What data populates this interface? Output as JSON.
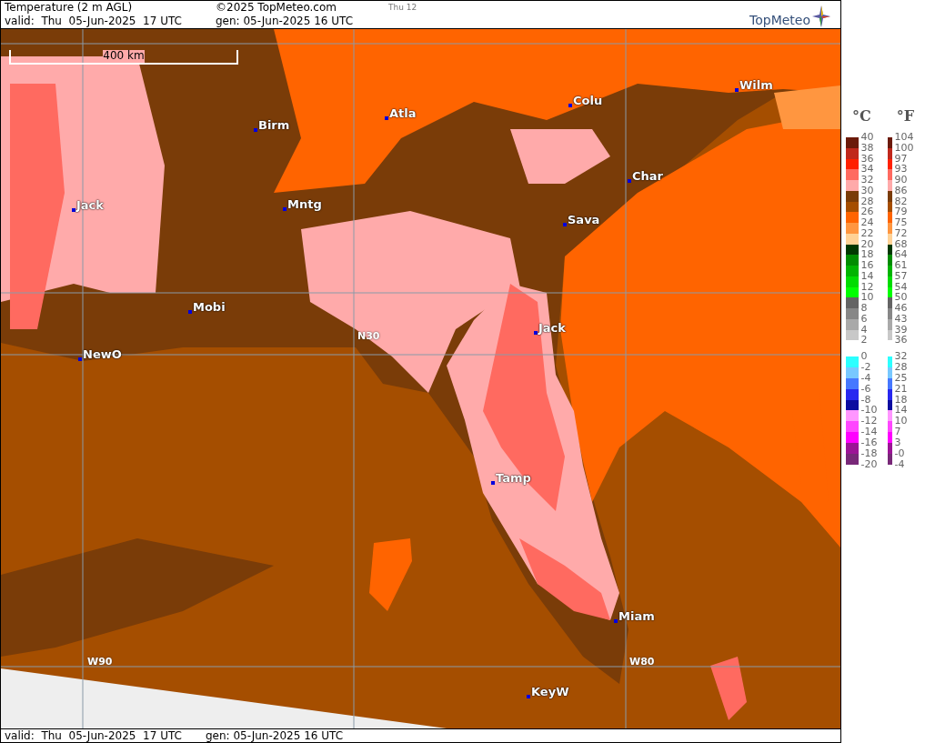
{
  "header": {
    "title": "Temperature (2 m AGL)",
    "copyright": "©2025 TopMeteo.com",
    "frame": "Thu 12",
    "valid": "valid:  Thu  05-Jun-2025  17 UTC",
    "generated": "gen: 05-Jun-2025 16 UTC",
    "logo": "TopMeteo"
  },
  "map": {
    "scale": "400 km",
    "cities": [
      "Birm",
      "Atla",
      "Colu",
      "Wilm",
      "Jack",
      "Mntg",
      "Char",
      "Sava",
      "Mobi",
      "Jack",
      "NewO",
      "Tamp",
      "Miam",
      "KeyW"
    ],
    "grid_labels": [
      "N30",
      "W90",
      "W80"
    ]
  },
  "legend": {
    "celsius_label": "°C",
    "fahrenheit_label": "°F",
    "groups": [
      {
        "ticks": [
          {
            "c": "40",
            "f": "104"
          },
          {
            "c": "38",
            "f": "100"
          },
          {
            "c": "36",
            "f": "97"
          },
          {
            "c": "34",
            "f": "93"
          },
          {
            "c": "32",
            "f": "90"
          },
          {
            "c": "30",
            "f": "86"
          },
          {
            "c": "28",
            "f": "82"
          },
          {
            "c": "26",
            "f": "79"
          },
          {
            "c": "24",
            "f": "75"
          },
          {
            "c": "22",
            "f": "72"
          },
          {
            "c": "20",
            "f": "68"
          },
          {
            "c": "18",
            "f": "64"
          },
          {
            "c": "16",
            "f": "61"
          },
          {
            "c": "14",
            "f": "57"
          },
          {
            "c": "12",
            "f": "54"
          },
          {
            "c": "10",
            "f": "50"
          },
          {
            "c": "8",
            "f": "46"
          },
          {
            "c": "6",
            "f": "43"
          },
          {
            "c": "4",
            "f": "39"
          },
          {
            "c": "2",
            "f": "36"
          }
        ],
        "bands": [
          {
            "color": "#6b1a0a"
          },
          {
            "color": "#c0281c"
          },
          {
            "color": "#ff2000"
          },
          {
            "color": "#ff6a60"
          },
          {
            "color": "#ffaaaa"
          },
          {
            "color": "#7a3c08"
          },
          {
            "color": "#a54e00"
          },
          {
            "color": "#ff6400"
          },
          {
            "color": "#ff9640"
          },
          {
            "color": "#ffd296"
          },
          {
            "color": "#003800"
          },
          {
            "color": "#008c00"
          },
          {
            "color": "#00b400"
          },
          {
            "color": "#00dc00"
          },
          {
            "color": "#00ff00"
          },
          {
            "color": "#646464"
          },
          {
            "color": "#878787"
          },
          {
            "color": "#a9a9a9"
          },
          {
            "color": "#c8c8c8"
          }
        ]
      },
      {
        "ticks": [
          {
            "c": "0",
            "f": "32"
          },
          {
            "c": "-2",
            "f": "28"
          },
          {
            "c": "-4",
            "f": "25"
          },
          {
            "c": "-6",
            "f": "21"
          },
          {
            "c": "-8",
            "f": "18"
          },
          {
            "c": "-10",
            "f": "14"
          },
          {
            "c": "-12",
            "f": "10"
          },
          {
            "c": "-14",
            "f": "7"
          },
          {
            "c": "-16",
            "f": "3"
          },
          {
            "c": "-18",
            "f": "-0"
          },
          {
            "c": "-20",
            "f": "-4"
          }
        ],
        "bands": [
          {
            "color": "#2cffff"
          },
          {
            "color": "#78c8ff"
          },
          {
            "color": "#4678ff"
          },
          {
            "color": "#2828f0"
          },
          {
            "color": "#0c0ca0"
          },
          {
            "color": "#ff96ff"
          },
          {
            "color": "#ff46ff"
          },
          {
            "color": "#ff00ff"
          },
          {
            "color": "#9c1496"
          },
          {
            "color": "#782878"
          }
        ]
      }
    ]
  },
  "footer": {
    "valid": "valid:  Thu  05-Jun-2025  17 UTC",
    "generated": "gen: 05-Jun-2025 16 UTC"
  }
}
